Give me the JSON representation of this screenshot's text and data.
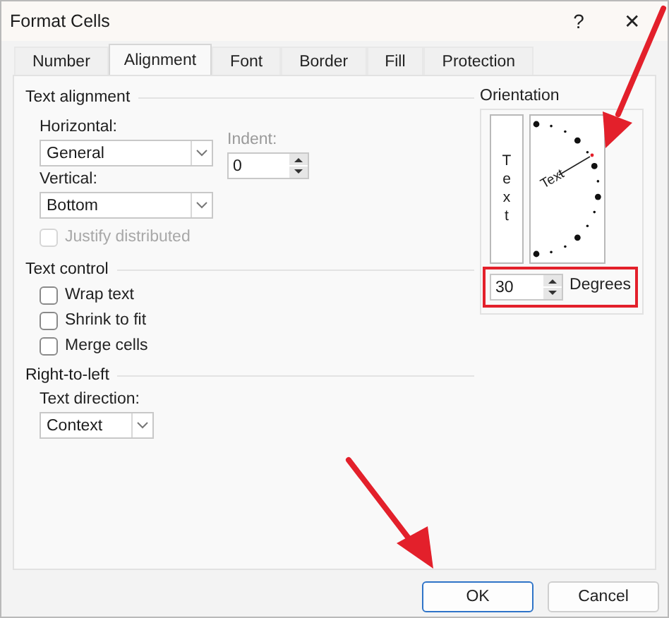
{
  "window": {
    "title": "Format Cells",
    "help": "?",
    "close": "✕"
  },
  "tabs": [
    {
      "label": "Number",
      "selected": false
    },
    {
      "label": "Alignment",
      "selected": true
    },
    {
      "label": "Font",
      "selected": false
    },
    {
      "label": "Border",
      "selected": false
    },
    {
      "label": "Fill",
      "selected": false
    },
    {
      "label": "Protection",
      "selected": false
    }
  ],
  "text_alignment": {
    "title": "Text alignment",
    "horizontal": {
      "label": "Horizontal:",
      "value": "General"
    },
    "vertical": {
      "label": "Vertical:",
      "value": "Bottom"
    },
    "indent": {
      "label": "Indent:",
      "value": "0",
      "disabled": true
    },
    "justify_distributed": {
      "label": "Justify distributed",
      "checked": false,
      "disabled": true
    }
  },
  "text_control": {
    "title": "Text control",
    "options": [
      {
        "label": "Wrap text",
        "checked": false
      },
      {
        "label": "Shrink to fit",
        "checked": false
      },
      {
        "label": "Merge cells",
        "checked": false
      }
    ]
  },
  "right_to_left": {
    "title": "Right-to-left",
    "text_direction": {
      "label": "Text direction:",
      "value": "Context"
    }
  },
  "orientation": {
    "title": "Orientation",
    "vertical_text": "Text",
    "dial_text": "Text",
    "degrees": {
      "value": "30",
      "label": "Degrees",
      "highlighted": true
    }
  },
  "buttons": [
    {
      "label": "OK",
      "default": true
    },
    {
      "label": "Cancel",
      "default": false
    }
  ]
}
